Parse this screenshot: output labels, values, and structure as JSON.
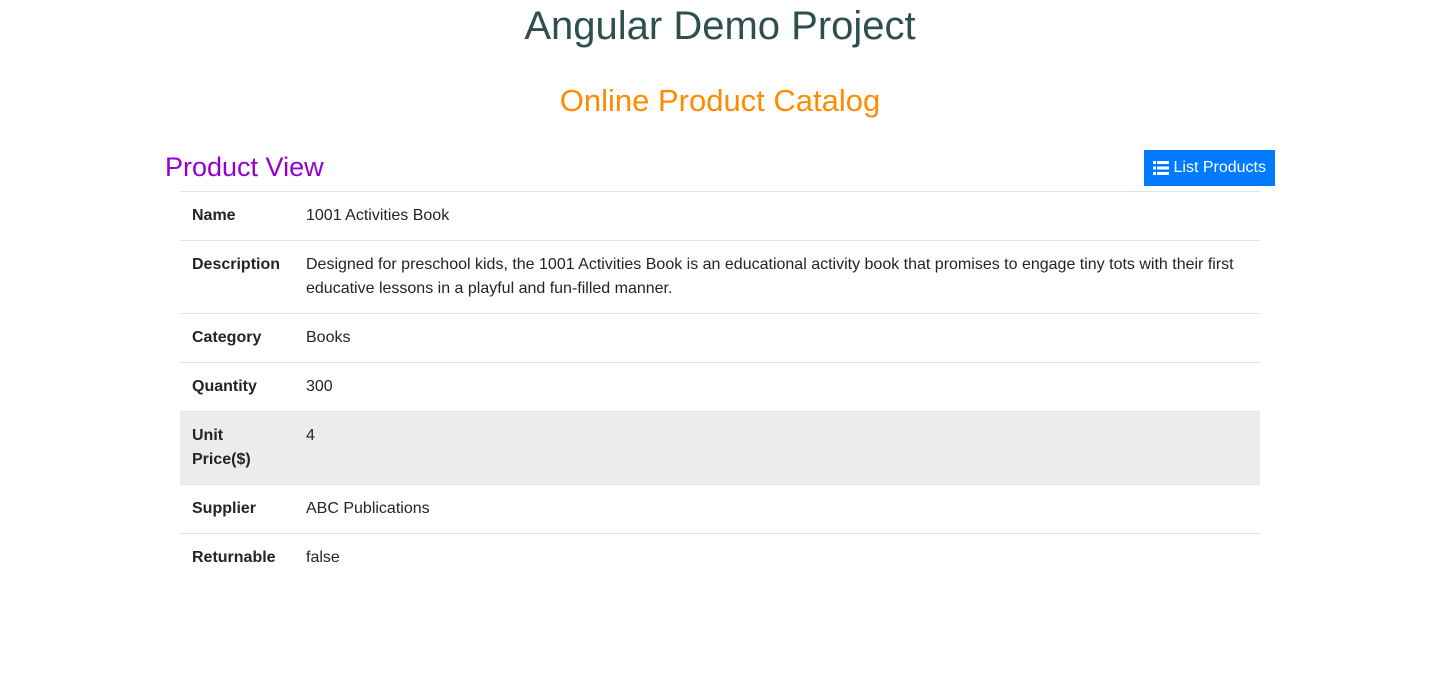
{
  "header": {
    "title": "Angular Demo Project",
    "subtitle": "Online Product Catalog"
  },
  "view": {
    "title": "Product View",
    "list_button_label": "List Products",
    "list_button_icon": "list-icon"
  },
  "colors": {
    "title": "#2f4f4f",
    "subtitle": "#ff8c00",
    "view_title": "#9400d3",
    "button": "#007bff",
    "highlight_row": "#ececec"
  },
  "product": {
    "rows": [
      {
        "label": "Name",
        "value": "1001 Activities Book"
      },
      {
        "label": "Description",
        "value": "Designed for preschool kids, the 1001 Activities Book is an educational activity book that promises to engage tiny tots with their first educative lessons in a playful and fun-filled manner."
      },
      {
        "label": "Category",
        "value": "Books"
      },
      {
        "label": "Quantity",
        "value": "300"
      },
      {
        "label": "Unit Price($)",
        "value": "4"
      },
      {
        "label": "Supplier",
        "value": "ABC Publications"
      },
      {
        "label": "Returnable",
        "value": "false"
      }
    ]
  }
}
